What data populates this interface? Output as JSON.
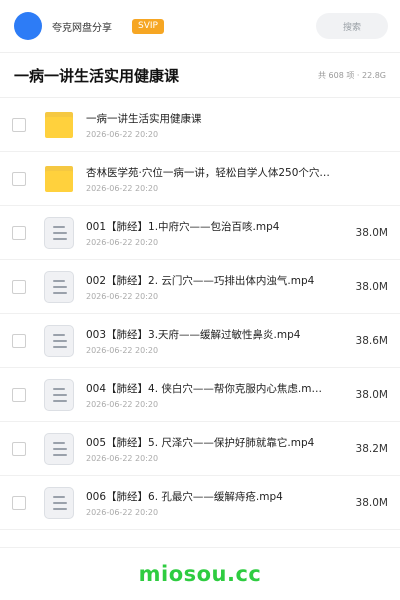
{
  "header": {
    "user_name": "夸克网盘分享",
    "badge": "SVIP",
    "search_placeholder": "搜索",
    "avatar_color": "#2d7cf6",
    "badge_color": "#f6a623"
  },
  "folder_title": "一病一讲生活实用健康课",
  "folder_summary": "共 608 项 · 22.8G",
  "files": [
    {
      "name": "一病一讲生活实用健康课",
      "date": "2026-06-22 20:20",
      "size": "",
      "icon": "folder-icon"
    },
    {
      "name": "杏林医学苑·穴位一病一讲，轻松自学人体250个穴…",
      "date": "2026-06-22 20:20",
      "size": "",
      "icon": "folder-icon"
    },
    {
      "name": "001【肺经】1.中府穴——包治百咳.mp4",
      "date": "2026-06-22 20:20",
      "size": "38.0M",
      "icon": "document-icon"
    },
    {
      "name": "002【肺经】2. 云门穴——巧排出体内浊气.mp4",
      "date": "2026-06-22 20:20",
      "size": "38.0M",
      "icon": "document-icon"
    },
    {
      "name": "003【肺经】3.天府——缓解过敏性鼻炎.mp4",
      "date": "2026-06-22 20:20",
      "size": "38.6M",
      "icon": "document-icon"
    },
    {
      "name": "004【肺经】4. 侠白穴——帮你克服内心焦虑.m…",
      "date": "2026-06-22 20:20",
      "size": "38.0M",
      "icon": "document-icon"
    },
    {
      "name": "005【肺经】5. 尺泽穴——保护好肺就靠它.mp4",
      "date": "2026-06-22 20:20",
      "size": "38.2M",
      "icon": "document-icon"
    },
    {
      "name": "006【肺经】6. 孔最穴——缓解痔疮.mp4",
      "date": "2026-06-22 20:20",
      "size": "38.0M",
      "icon": "document-icon"
    }
  ],
  "watermark": "miosou.cc",
  "watermark_color": "#2ecc40"
}
